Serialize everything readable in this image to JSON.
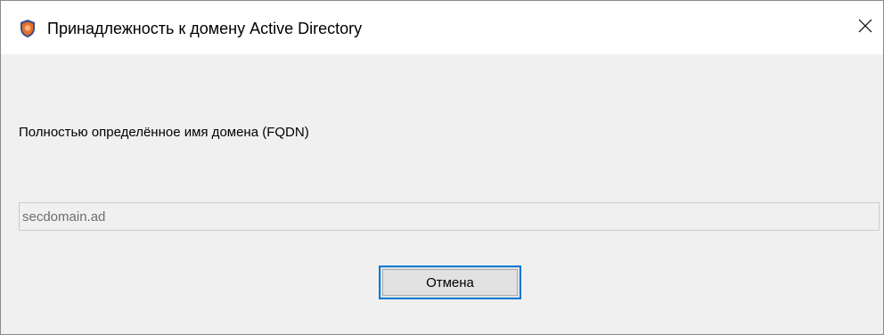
{
  "window": {
    "title": "Принадлежность к домену Active Directory",
    "icon": "shield-icon",
    "close_icon": "close-icon"
  },
  "form": {
    "fqdn_label": "Полностью определённое имя домена (FQDN)",
    "fqdn_value": "secdomain.ad",
    "fqdn_disabled": true
  },
  "buttons": {
    "cancel_label": "Отмена"
  },
  "colors": {
    "accent": "#0078d7",
    "dialog_background": "#f0f0f0",
    "titlebar_background": "#ffffff",
    "shield_orange": "#e8702a",
    "shield_blue": "#3a4f8a"
  }
}
